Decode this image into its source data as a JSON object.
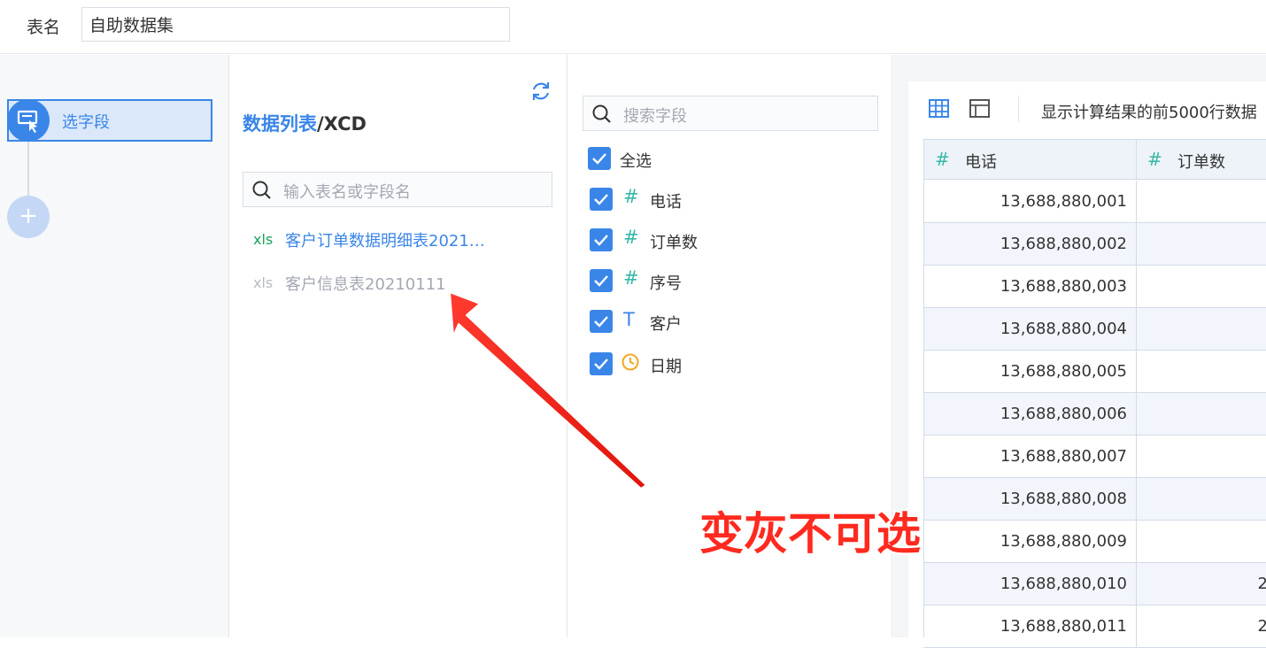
{
  "topbar": {
    "table_name_label": "表名",
    "table_name_value": "自助数据集"
  },
  "steps": {
    "select_fields_label": "选字段",
    "add_label": "+"
  },
  "data_list": {
    "title_prefix": "数据列表",
    "title_suffix": "/XCD",
    "search_placeholder": "输入表名或字段名",
    "tables": [
      {
        "type_badge": "xls",
        "name": "客户订单数据明细表2021…",
        "enabled": true
      },
      {
        "type_badge": "xls",
        "name": "客户信息表20210111",
        "enabled": false
      }
    ]
  },
  "fields": {
    "search_placeholder": "搜索字段",
    "select_all_label": "全选",
    "items": [
      {
        "type_icon": "#",
        "label": "电话",
        "checked": true
      },
      {
        "type_icon": "#",
        "label": "订单数",
        "checked": true
      },
      {
        "type_icon": "#",
        "label": "序号",
        "checked": true
      },
      {
        "type_icon": "T",
        "label": "客户",
        "checked": true
      },
      {
        "type_icon": "clock-icon",
        "label": "日期",
        "checked": true
      }
    ]
  },
  "preview": {
    "note": "显示计算结果的前5000行数据",
    "columns": [
      {
        "type_icon": "#",
        "label": "电话"
      },
      {
        "type_icon": "#",
        "label": "订单数"
      }
    ],
    "rows": [
      "13,688,880,001",
      "13,688,880,002",
      "13,688,880,003",
      "13,688,880,004",
      "13,688,880,005",
      "13,688,880,006",
      "13,688,880,007",
      "13,688,880,008",
      "13,688,880,009",
      "13,688,880,010",
      "13,688,880,011"
    ],
    "second_col_partial": {
      "9": "2",
      "10": "2"
    }
  },
  "annotation": {
    "text": "变灰不可选"
  },
  "colors": {
    "accent": "#3a86e8",
    "number_type": "#36b8a6",
    "date_type": "#f5a623",
    "xls": "#1aa35b",
    "annotation": "#ff2a1f"
  }
}
